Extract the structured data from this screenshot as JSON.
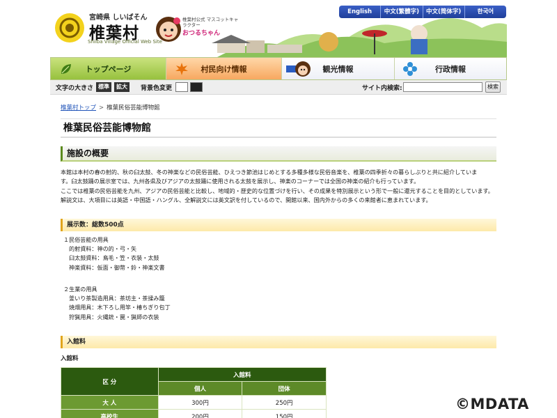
{
  "header": {
    "prefecture": "宮崎県 しいばそん",
    "village_name": "椎葉村",
    "site_en": "Shiiba Village Official Web Site",
    "mascot_note": "椎葉村公式 マスコットキャラクター",
    "mascot_name": "おつるちゃん",
    "languages": [
      "English",
      "中文(繁體字)",
      "中文(简体字)",
      "한국어"
    ]
  },
  "global_nav": {
    "items": [
      {
        "label": "トップページ",
        "icon": "leaf-icon"
      },
      {
        "label": "村民向け情報",
        "icon": "maple-leaf-icon"
      },
      {
        "label": "観光情報",
        "icon": "mascot-icon"
      },
      {
        "label": "行政情報",
        "icon": "flower-icon"
      }
    ]
  },
  "toolbar": {
    "font_size_label": "文字の大きさ",
    "font_standard": "標準",
    "font_large": "拡大",
    "bg_color_label": "背景色変更",
    "search_label": "サイト内検索:",
    "search_placeholder": "",
    "search_button": "検索"
  },
  "breadcrumb": {
    "home": "椎葉村トップ",
    "separator": ">",
    "current": "椎葉民俗芸能博物館"
  },
  "page": {
    "title": "椎葉民俗芸能博物館",
    "section_overview": "施設の概要",
    "overview_lines": [
      "本館は本村の春の射的、秋の臼太鼓、冬の神楽などの民俗芸能、ひえつき節池はじめとする多種多様な民俗音楽を、椎葉の四季折々の暮らしぶりと共に紹介していま",
      "す。臼太鼓踊の展示室では、九州各県及びアジアの太鼓踊に使用される太鼓を展示し、神楽のコーナーでは全国の神楽の紹介も行っています。",
      "ここでは椎葉の民俗芸能を九州、アジアの民俗芸能と比較し、地域的・歴史的な位置づけを行い、その成果を特別展示という形で一般に還元することを目的としています。",
      "解説文は、大項目には英語・中国語・ハングル、全解説文には英文訳を付しているので、開館以来、国内外からの多くの来館者に恵まれています。"
    ],
    "exhibits_heading": "展示数：総数500点",
    "exhibits_group1": {
      "title": "１民俗芸能の用具",
      "items": [
        "的射資料：神の的・弓・矢",
        "臼太鼓資料：鳥毛・笠・衣装・太鼓",
        "神楽資料：仮面・御幣・鈴・神楽文書"
      ]
    },
    "exhibits_group2": {
      "title": "２生業の用具",
      "items": [
        "釜いり茶製造用具：茶坊主・茶揉み籠",
        "焼畑用具：木下ろし用竿・椿ちぎり包丁",
        "狩猟用具：火縄銃・罠・猟師の衣装"
      ]
    },
    "fee_heading": "入館料",
    "fee_label": "入館料",
    "fee_table": {
      "col_category": "区 分",
      "col_fee": "入館料",
      "col_individual": "個人",
      "col_group": "団体",
      "rows": [
        {
          "category": "大 人",
          "individual": "300円",
          "group": "250円"
        },
        {
          "category": "高校生",
          "individual": "200円",
          "group": "150円"
        }
      ]
    }
  },
  "watermark": "©MDATA",
  "colors": {
    "nav_top": "#97c13e",
    "nav_residents": "#f7a860",
    "lang_bar": "#1f3f9a",
    "section_accent": "#5b8a1e",
    "subsection_bg": "#fde9a9",
    "table_header": "#2c5a0f",
    "link": "#1f53b8"
  }
}
